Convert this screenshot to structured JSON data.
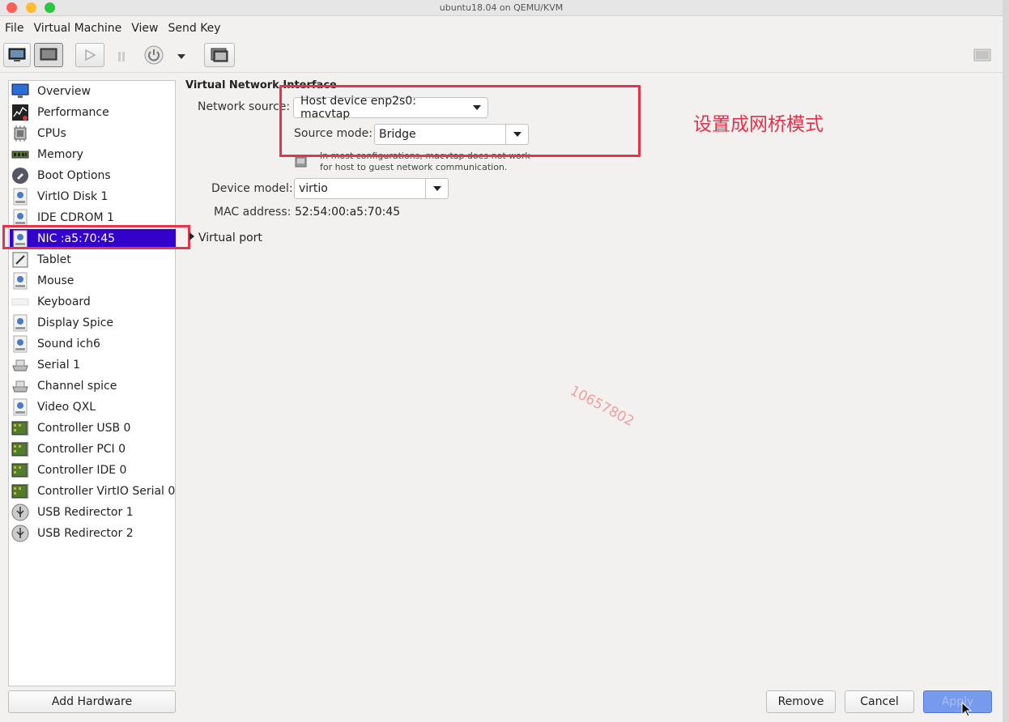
{
  "window": {
    "title": "ubuntu18.04 on QEMU/KVM"
  },
  "menu": [
    "File",
    "Virtual Machine",
    "View",
    "Send Key"
  ],
  "sidebar": {
    "items": [
      {
        "label": "Overview",
        "icon": "monitor-icon"
      },
      {
        "label": "Performance",
        "icon": "performance-icon"
      },
      {
        "label": "CPUs",
        "icon": "cpu-icon"
      },
      {
        "label": "Memory",
        "icon": "memory-icon"
      },
      {
        "label": "Boot Options",
        "icon": "boot-icon"
      },
      {
        "label": "VirtIO Disk 1",
        "icon": "disk-image-icon"
      },
      {
        "label": "IDE CDROM 1",
        "icon": "disk-image-icon"
      },
      {
        "label": "NIC :a5:70:45",
        "icon": "nic-icon",
        "selected": true
      },
      {
        "label": "Tablet",
        "icon": "tablet-icon"
      },
      {
        "label": "Mouse",
        "icon": "mouse-icon"
      },
      {
        "label": "Keyboard",
        "icon": "keyboard-icon"
      },
      {
        "label": "Display Spice",
        "icon": "display-icon"
      },
      {
        "label": "Sound ich6",
        "icon": "sound-icon"
      },
      {
        "label": "Serial 1",
        "icon": "serial-icon"
      },
      {
        "label": "Channel spice",
        "icon": "channel-icon"
      },
      {
        "label": "Video QXL",
        "icon": "video-icon"
      },
      {
        "label": "Controller USB 0",
        "icon": "controller-icon"
      },
      {
        "label": "Controller PCI 0",
        "icon": "controller-icon"
      },
      {
        "label": "Controller IDE 0",
        "icon": "controller-icon"
      },
      {
        "label": "Controller VirtIO Serial 0",
        "icon": "controller-icon"
      },
      {
        "label": "USB Redirector 1",
        "icon": "usb-icon"
      },
      {
        "label": "USB Redirector 2",
        "icon": "usb-icon"
      }
    ],
    "add_hardware": "Add Hardware"
  },
  "nic": {
    "section_title": "Virtual Network Interface",
    "network_source_label": "Network source:",
    "network_source_value": "Host device enp2s0: macvtap",
    "source_mode_label": "Source mode:",
    "source_mode_value": "Bridge",
    "warning_line1": "In most configurations, macvtap does not work",
    "warning_line2": "for host to guest network communication.",
    "device_model_label": "Device model:",
    "device_model_value": "virtio",
    "mac_label": "MAC address:",
    "mac_value": "52:54:00:a5:70:45",
    "virtual_port": "Virtual port"
  },
  "annotation": "设置成网桥模式",
  "watermark": "10657802",
  "buttons": {
    "remove": "Remove",
    "cancel": "Cancel",
    "apply": "Apply"
  },
  "colors": {
    "selection": "#3300cc",
    "highlight_box": "#e8334d",
    "apply": "#7799ee"
  }
}
